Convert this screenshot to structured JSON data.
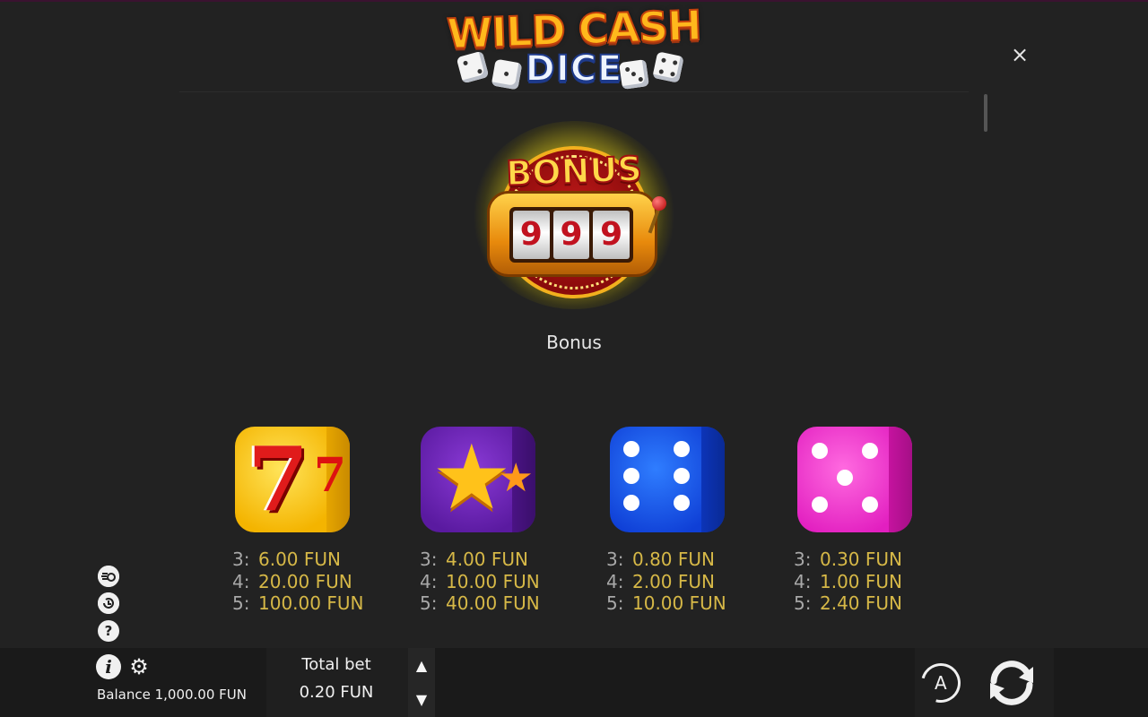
{
  "header": {
    "logo_line1": "WILD CASH",
    "logo_line2": "DICE",
    "close_symbol": "×"
  },
  "bonus": {
    "badge_text": "BONUS",
    "reels": [
      "9",
      "9",
      "9"
    ],
    "label": "Bonus"
  },
  "paytable": [
    {
      "symbol": "red-seven-die",
      "glyph": "7",
      "rows": [
        {
          "n": "3:",
          "v": "6.00 FUN"
        },
        {
          "n": "4:",
          "v": "20.00 FUN"
        },
        {
          "n": "5:",
          "v": "100.00 FUN"
        }
      ]
    },
    {
      "symbol": "star-die",
      "glyph": "★",
      "rows": [
        {
          "n": "3:",
          "v": "4.00 FUN"
        },
        {
          "n": "4:",
          "v": "10.00 FUN"
        },
        {
          "n": "5:",
          "v": "40.00 FUN"
        }
      ]
    },
    {
      "symbol": "blue-six-die",
      "rows": [
        {
          "n": "3:",
          "v": "0.80 FUN"
        },
        {
          "n": "4:",
          "v": "2.00 FUN"
        },
        {
          "n": "5:",
          "v": "10.00 FUN"
        }
      ]
    },
    {
      "symbol": "pink-five-die",
      "rows": [
        {
          "n": "3:",
          "v": "0.30 FUN"
        },
        {
          "n": "4:",
          "v": "1.00 FUN"
        },
        {
          "n": "5:",
          "v": "2.40 FUN"
        }
      ]
    }
  ],
  "side_icons": [
    "turbo-icon",
    "history-icon",
    "help-icon"
  ],
  "help_symbol": "?",
  "footer": {
    "info_symbol": "i",
    "gear_symbol": "⚙",
    "balance": "Balance 1,000.00 FUN",
    "total_bet_label": "Total bet",
    "total_bet_value": "0.20 FUN",
    "bet_up_symbol": "▲",
    "bet_down_symbol": "▼",
    "autoplay_symbol": "A"
  },
  "colors": {
    "background": "#222222",
    "payout_value": "#d6b847",
    "payout_count": "#a8a8a8"
  }
}
